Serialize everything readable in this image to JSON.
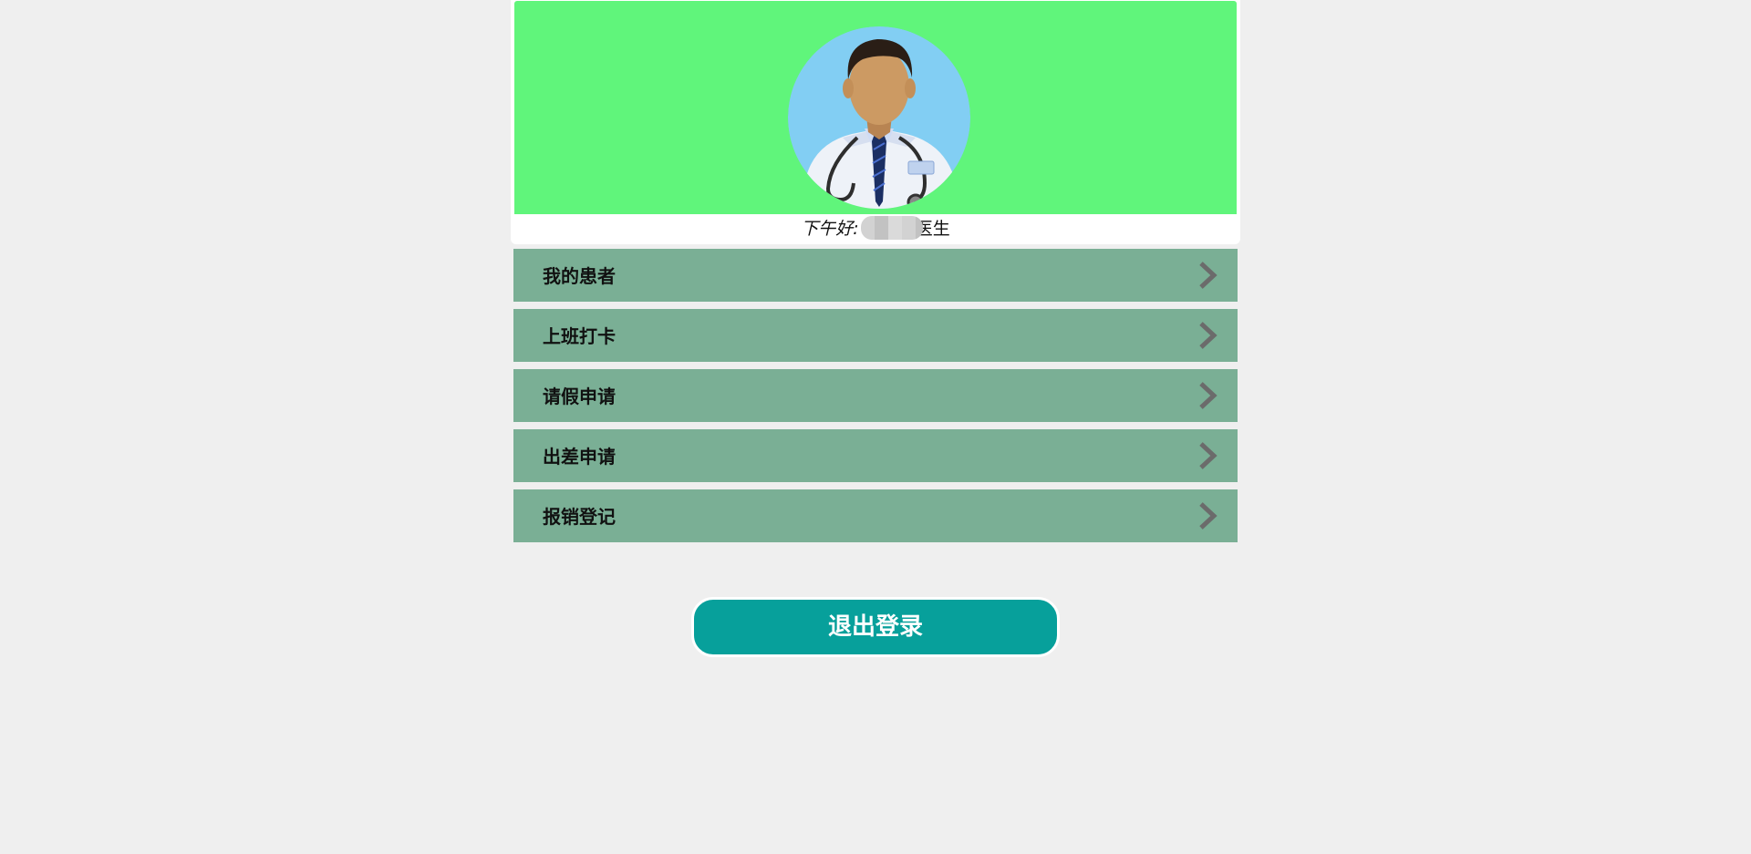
{
  "header": {
    "greeting_prefix": "下午好:",
    "greeting_suffix": "医生",
    "banner_color": "#60f57b",
    "avatar_icon": "doctor-avatar-icon"
  },
  "menu": {
    "items": [
      {
        "label": "我的患者",
        "icon": "chevron-right-icon"
      },
      {
        "label": "上班打卡",
        "icon": "chevron-right-icon"
      },
      {
        "label": "请假申请",
        "icon": "chevron-right-icon"
      },
      {
        "label": "出差申请",
        "icon": "chevron-right-icon"
      },
      {
        "label": "报销登记",
        "icon": "chevron-right-icon"
      }
    ],
    "item_color": "#7aaf95"
  },
  "logout": {
    "label": "退出登录",
    "color": "#07a09b"
  }
}
